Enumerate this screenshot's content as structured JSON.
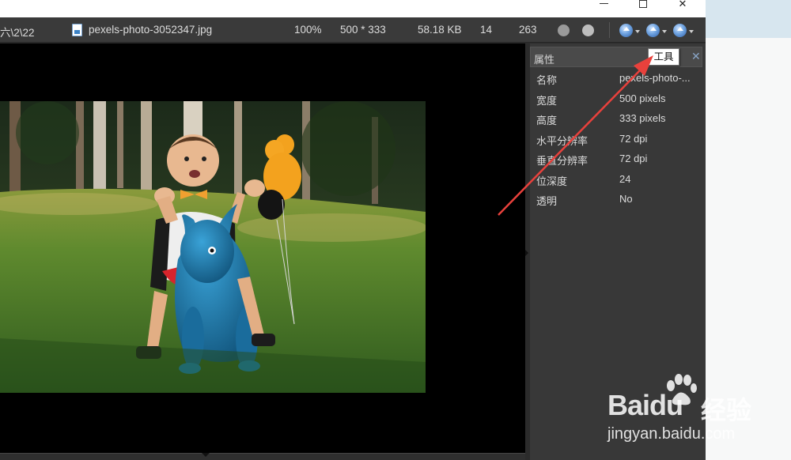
{
  "window": {
    "minimize_glyph": "—",
    "close_glyph": "✕"
  },
  "toolbar": {
    "path_fragment": "六\\2\\22",
    "file_name": "pexels-photo-3052347.jpg",
    "zoom": "100%",
    "dimensions": "500 * 333",
    "file_size": "58.18 KB",
    "index": "14",
    "count": "263"
  },
  "panel": {
    "title": "属性",
    "close_glyph": "✕",
    "tooltip": "工具",
    "properties": [
      {
        "key": "名称",
        "value": "pexels-photo-..."
      },
      {
        "key": "宽度",
        "value": "500 pixels"
      },
      {
        "key": "高度",
        "value": "333 pixels"
      },
      {
        "key": "水平分辨率",
        "value": "72 dpi"
      },
      {
        "key": "垂直分辨率",
        "value": "72 dpi"
      },
      {
        "key": "位深度",
        "value": "24"
      },
      {
        "key": "透明",
        "value": "No"
      }
    ]
  },
  "annotation": {
    "arrow_color": "#e8413c"
  },
  "watermark": {
    "brand": "Bai",
    "brand_du": "du",
    "cn": "经验",
    "url": "jingyan.baidu.com"
  },
  "colors": {
    "toolbar_bg": "#3a3a3a",
    "panel_bg": "#383838",
    "canvas_bg": "#000000",
    "accent_blue": "#3b82c6"
  },
  "icons": [
    "file-jpg-icon",
    "rotate-left-icon",
    "rotate-right-icon",
    "nav-up-icon",
    "nav-prev-icon",
    "nav-next-icon",
    "close-icon",
    "minimize-icon",
    "maximize-icon"
  ]
}
